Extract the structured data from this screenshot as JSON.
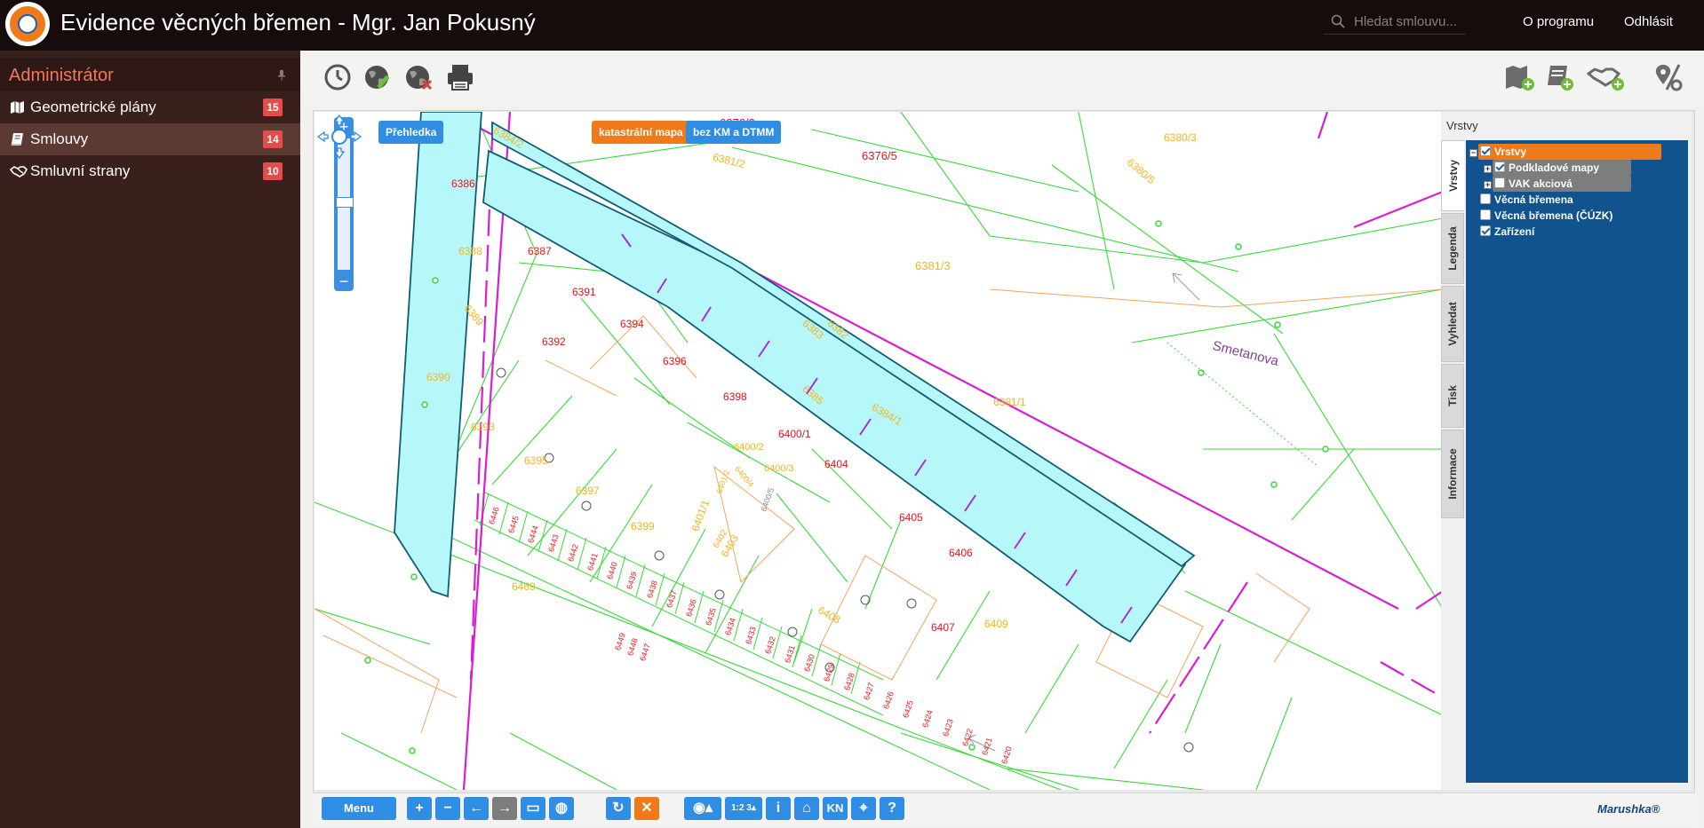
{
  "header": {
    "title": "Evidence věcných břemen - Mgr. Jan Pokusný",
    "search_placeholder": "Hledat smlouvu...",
    "about_label": "O programu",
    "logout_label": "Odhlásit"
  },
  "sidebar": {
    "title": "Administrátor",
    "items": [
      {
        "label": "Geometrické plány",
        "count": "15",
        "icon": "map-icon"
      },
      {
        "label": "Smlouvy",
        "count": "14",
        "icon": "book-icon"
      },
      {
        "label": "Smluvní strany",
        "count": "10",
        "icon": "handshake-icon"
      }
    ]
  },
  "map": {
    "buttons": {
      "overview": "Přehledka",
      "cadastral": "katastrální mapa",
      "without": "bez KM a DTMM"
    },
    "street_label": "Smetanova",
    "parcels": [
      {
        "text": "6376/3",
        "color": "red"
      },
      {
        "text": "6376/5",
        "color": "red"
      },
      {
        "text": "6380/3",
        "color": "yellow"
      },
      {
        "text": "6380/5",
        "color": "yellow"
      },
      {
        "text": "6384/2",
        "color": "yellow"
      },
      {
        "text": "6381/2",
        "color": "yellow"
      },
      {
        "text": "6386",
        "color": "red"
      },
      {
        "text": "6388",
        "color": "yellow"
      },
      {
        "text": "6387",
        "color": "red"
      },
      {
        "text": "6381/3",
        "color": "yellow"
      },
      {
        "text": "6391",
        "color": "red"
      },
      {
        "text": "6389",
        "color": "yellow"
      },
      {
        "text": "6394",
        "color": "red"
      },
      {
        "text": "6392",
        "color": "red"
      },
      {
        "text": "6383",
        "color": "yellow"
      },
      {
        "text": "6382",
        "color": "yellow"
      },
      {
        "text": "6396",
        "color": "red"
      },
      {
        "text": "6390",
        "color": "yellow"
      },
      {
        "text": "6398",
        "color": "red"
      },
      {
        "text": "6385",
        "color": "yellow"
      },
      {
        "text": "6384/1",
        "color": "yellow"
      },
      {
        "text": "6381/1",
        "color": "yellow"
      },
      {
        "text": "6393",
        "color": "yellow"
      },
      {
        "text": "6400/1",
        "color": "red"
      },
      {
        "text": "6400/2",
        "color": "yellow"
      },
      {
        "text": "6400/3",
        "color": "yellow"
      },
      {
        "text": "6404",
        "color": "red"
      },
      {
        "text": "6395",
        "color": "yellow"
      },
      {
        "text": "6397",
        "color": "yellow"
      },
      {
        "text": "6401/2",
        "color": "yellow"
      },
      {
        "text": "6400/4",
        "color": "yellow"
      },
      {
        "text": "6400/5",
        "color": "gray"
      },
      {
        "text": "6405",
        "color": "red"
      },
      {
        "text": "6399",
        "color": "yellow"
      },
      {
        "text": "6401/1",
        "color": "yellow"
      },
      {
        "text": "6402",
        "color": "yellow"
      },
      {
        "text": "6403",
        "color": "yellow"
      },
      {
        "text": "6406",
        "color": "red"
      },
      {
        "text": "6469",
        "color": "yellow"
      },
      {
        "text": "6408",
        "color": "yellow"
      },
      {
        "text": "6409",
        "color": "yellow"
      },
      {
        "text": "6407",
        "color": "red"
      },
      {
        "text": "6446",
        "color": "red"
      },
      {
        "text": "6445",
        "color": "red"
      },
      {
        "text": "6444",
        "color": "red"
      },
      {
        "text": "6443",
        "color": "red"
      },
      {
        "text": "6442",
        "color": "red"
      },
      {
        "text": "6441",
        "color": "red"
      },
      {
        "text": "6440",
        "color": "red"
      },
      {
        "text": "6439",
        "color": "red"
      },
      {
        "text": "6438",
        "color": "red"
      },
      {
        "text": "6437",
        "color": "red"
      },
      {
        "text": "6436",
        "color": "red"
      },
      {
        "text": "6435",
        "color": "red"
      },
      {
        "text": "6434",
        "color": "red"
      },
      {
        "text": "6433",
        "color": "red"
      },
      {
        "text": "6432",
        "color": "red"
      },
      {
        "text": "6431",
        "color": "red"
      },
      {
        "text": "6430",
        "color": "red"
      },
      {
        "text": "6429",
        "color": "red"
      },
      {
        "text": "6428",
        "color": "red"
      },
      {
        "text": "6427",
        "color": "red"
      },
      {
        "text": "6426",
        "color": "red"
      },
      {
        "text": "6425",
        "color": "red"
      },
      {
        "text": "6424",
        "color": "red"
      },
      {
        "text": "6423",
        "color": "red"
      },
      {
        "text": "6422",
        "color": "red"
      },
      {
        "text": "6421",
        "color": "red"
      },
      {
        "text": "6420",
        "color": "red"
      },
      {
        "text": "6447",
        "color": "red"
      },
      {
        "text": "6448",
        "color": "red"
      },
      {
        "text": "6449",
        "color": "red"
      }
    ]
  },
  "layers": {
    "panel_title": "Vrstvy",
    "tabs": [
      "Vrstvy",
      "Legenda",
      "Vyhledat",
      "Tisk",
      "Informace"
    ],
    "items": [
      {
        "label": "Vrstvy",
        "checked": true
      },
      {
        "label": "Podkladové mapy",
        "checked": true
      },
      {
        "label": "VAK akciová",
        "checked": false
      },
      {
        "label": "Věcná břemena",
        "checked": false
      },
      {
        "label": "Věcná břemena (ČÚZK)",
        "checked": false
      },
      {
        "label": "Zařízení",
        "checked": true
      }
    ]
  },
  "bottombar": {
    "menu_label": "Menu",
    "kn_label": "KN",
    "info_label": "i",
    "help_label": "?",
    "scale_label": "1:2 3",
    "brand": "Marushka®"
  },
  "colors": {
    "topbar": "#150c0b",
    "sidebar": "#3a201c",
    "accent_orange": "#f07a1a",
    "accent_blue": "#2f8de4",
    "badge_red": "#e54b4b",
    "layer_panel": "#10538e",
    "parcel_red": "#e8141b",
    "parcel_yellow": "#f2b51e",
    "line_green": "#39d839",
    "line_magenta": "#d81ed0",
    "corridor_fill": "#b6f8fa"
  }
}
